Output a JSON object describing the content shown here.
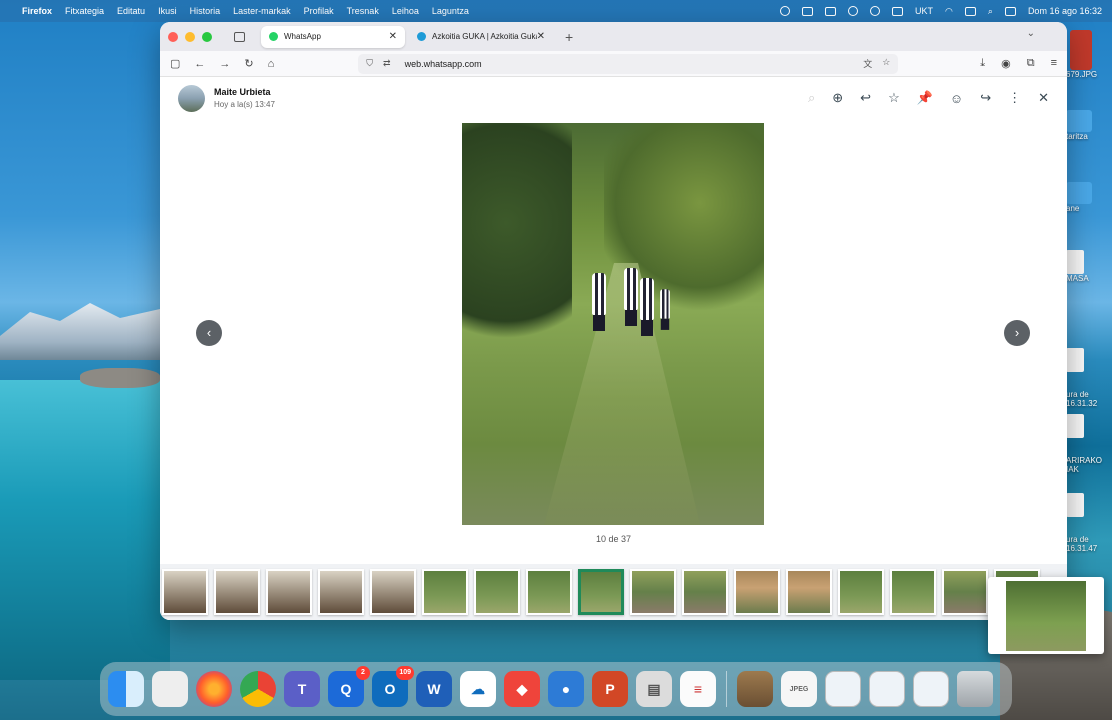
{
  "menubar": {
    "app": "Firefox",
    "menus": [
      "Fitxategia",
      "Editatu",
      "Ikusi",
      "Historia",
      "Laster-markak",
      "Profilak",
      "Tresnak",
      "Leihoa",
      "Laguntza"
    ],
    "input_source": "UKT",
    "clock": "Dom 16 ago  16:32"
  },
  "desktop": {
    "items": [
      "679.JPG",
      "taritza",
      "ane",
      "MASA",
      "ura de\n16.31.32",
      "ARIRAKO\nIAK",
      "ura de\n16.31.47"
    ]
  },
  "browser": {
    "tabs": [
      {
        "title": "WhatsApp",
        "active": true
      },
      {
        "title": "Azkoitia GUKA | Azkoitia Guka",
        "active": false
      }
    ],
    "url_host": "web.whatsapp.com"
  },
  "viewer": {
    "sender_name": "Maite Urbieta",
    "sender_time": "Hoy a la(s) 13:47",
    "counter": "10 de 37",
    "prev_arrow": "‹",
    "next_arrow": "›",
    "thumb_count": 17,
    "active_thumb_index": 8
  },
  "dock": {
    "apps": [
      {
        "name": "finder",
        "label": ""
      },
      {
        "name": "launchpad",
        "label": ""
      },
      {
        "name": "firefox",
        "label": ""
      },
      {
        "name": "chrome",
        "label": ""
      },
      {
        "name": "teams",
        "label": "T"
      },
      {
        "name": "qr-app",
        "label": "Q",
        "badge": "2"
      },
      {
        "name": "outlook",
        "label": "O",
        "badge": "109"
      },
      {
        "name": "word",
        "label": "W"
      },
      {
        "name": "onedrive",
        "label": "☁"
      },
      {
        "name": "anydesk",
        "label": "◆"
      },
      {
        "name": "zoom",
        "label": "●"
      },
      {
        "name": "powerpoint",
        "label": "P"
      },
      {
        "name": "preview",
        "label": "▤"
      },
      {
        "name": "notes",
        "label": "≡"
      }
    ],
    "docs": [
      "photo",
      "JPEG",
      "screenshot",
      "screenshot",
      "screenshot"
    ]
  },
  "colors": {
    "whatsapp_green": "#25d366",
    "active_thumb_border": "#1f8a5a"
  }
}
